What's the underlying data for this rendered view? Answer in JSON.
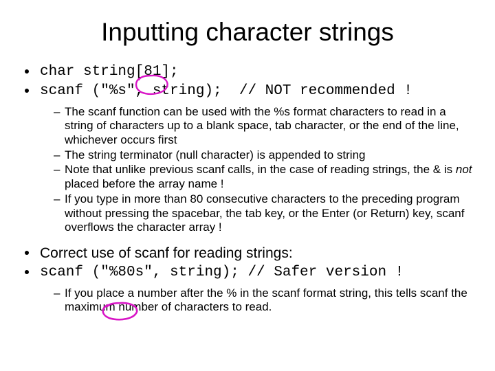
{
  "title": "Inputting character strings",
  "code1": "char string[81];",
  "code2": "scanf (\"%s\", string);  // NOT recommended !",
  "sub1": [
    "The scanf function can be used with the %s format characters to read in a string of characters up to a blank space, tab character, or the end of the line, whichever occurs first",
    "The string terminator (null character) is appended to string",
    "Note that unlike previous scanf calls, in the case of reading strings, the & is ",
    " placed before the array name !",
    "If you type in more than 80 consecutive characters to the preceding program without pressing the spacebar, the tab key, or the Enter (or Return) key, scanf overflows the character array !"
  ],
  "not_word": "not",
  "correct_line": "Correct use of scanf for reading strings:",
  "code3": "scanf (\"%80s\", string); // Safer version !",
  "sub2": "If you place a number after the % in the scanf format string, this tells scanf the maximum number of characters to read."
}
